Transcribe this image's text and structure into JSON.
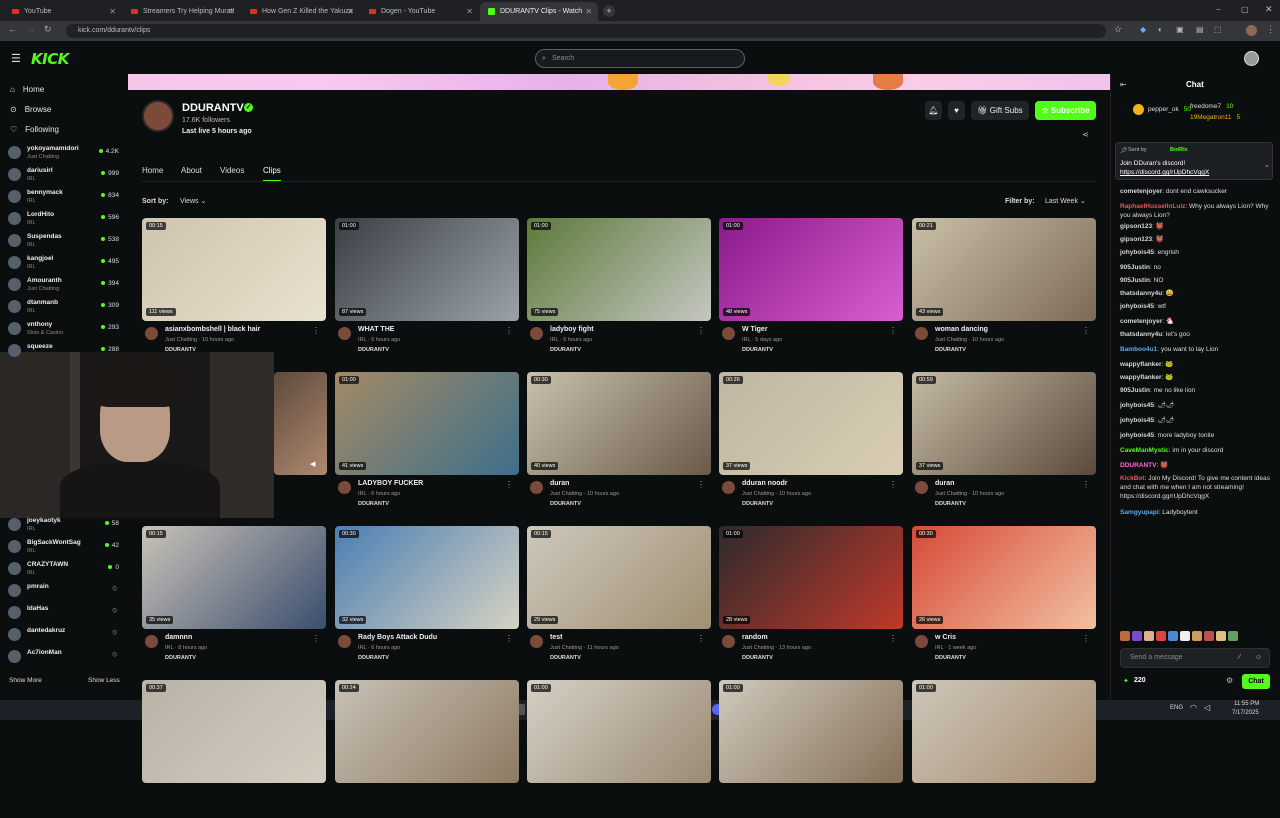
{
  "browser": {
    "tabs": [
      {
        "title": "YouTube",
        "icon": "youtube-icon",
        "active": false
      },
      {
        "title": "Streamers Try Helping Murat!",
        "icon": "youtube-icon",
        "active": false
      },
      {
        "title": "How Gen Z Killed the Yakuza",
        "icon": "youtube-icon",
        "active": false
      },
      {
        "title": "Dogen - YouTube",
        "icon": "youtube-icon",
        "active": false
      },
      {
        "title": "DDURANTV Clips - Watch",
        "icon": "kick-icon",
        "active": true
      }
    ],
    "url": "kick.com/ddurantv/clips"
  },
  "header": {
    "logo": "KICK",
    "search_placeholder": "Search"
  },
  "sidebar": {
    "nav": [
      {
        "label": "Home",
        "icon": "home-icon"
      },
      {
        "label": "Browse",
        "icon": "compass-icon"
      },
      {
        "label": "Following",
        "icon": "heart-icon"
      }
    ],
    "following": [
      {
        "name": "yokoyamamidori",
        "category": "Just Chatting",
        "viewers": "4.2K",
        "live": true
      },
      {
        "name": "dariusirl",
        "category": "IRL",
        "viewers": "999",
        "live": true
      },
      {
        "name": "bennymack",
        "category": "IRL",
        "viewers": "834",
        "live": true
      },
      {
        "name": "LordHito",
        "category": "IRL",
        "viewers": "596",
        "live": true
      },
      {
        "name": "Suspendas",
        "category": "IRL",
        "viewers": "538",
        "live": true
      },
      {
        "name": "kangjoel",
        "category": "IRL",
        "viewers": "495",
        "live": true
      },
      {
        "name": "Amouranth",
        "category": "Just Chatting",
        "viewers": "394",
        "live": true
      },
      {
        "name": "dtanmanb",
        "category": "IRL",
        "viewers": "309",
        "live": true
      },
      {
        "name": "vnthony",
        "category": "Slots & Casino",
        "viewers": "293",
        "live": true
      },
      {
        "name": "squeeze",
        "category": "",
        "viewers": "288",
        "live": true
      }
    ],
    "following_lower": [
      {
        "name": "joeykaotyk",
        "category": "IRL",
        "viewers": "58",
        "live": true
      },
      {
        "name": "BigSackWontSag",
        "category": "IRL",
        "viewers": "42",
        "live": true
      },
      {
        "name": "CRAZYTAWN",
        "category": "IRL",
        "viewers": "0",
        "live": true
      },
      {
        "name": "pmrain",
        "category": "",
        "viewers": "",
        "live": false
      },
      {
        "name": "IdaHas",
        "category": "",
        "viewers": "",
        "live": false
      },
      {
        "name": "dantedakruz",
        "category": "",
        "viewers": "",
        "live": false
      },
      {
        "name": "Ac7ionMan",
        "category": "",
        "viewers": "",
        "live": false
      }
    ],
    "show_more": "Show More",
    "show_less": "Show Less"
  },
  "channel": {
    "name": "DDURANTV",
    "followers": "17.6K followers",
    "last_live": "Last live 5 hours ago",
    "gift_subs": "Gift Subs",
    "subscribe": "Subscribe",
    "tabs": [
      "Home",
      "About",
      "Videos",
      "Clips"
    ],
    "active_tab": "Clips",
    "sort_label": "Sort by:",
    "sort_value": "Views",
    "filter_label": "Filter by:",
    "filter_value": "Last Week"
  },
  "clips": [
    {
      "duration": "00:15",
      "views": "111 views",
      "title": "asianxbombshell | black hair",
      "meta": "Just Chatting · 10 hours ago",
      "channel": "DDURANTV",
      "c1": "#cfc4ad",
      "c2": "#e9e2cf"
    },
    {
      "duration": "01:00",
      "views": "87 views",
      "title": "WHAT THE",
      "meta": "IRL · 6 hours ago",
      "channel": "DDURANTV",
      "c1": "#3b3f45",
      "c2": "#9aa3a9"
    },
    {
      "duration": "01:00",
      "views": "75 views",
      "title": "ladyboy fight",
      "meta": "IRL · 6 hours ago",
      "channel": "DDURANTV",
      "c1": "#5c7a3a",
      "c2": "#c5c7c2"
    },
    {
      "duration": "01:00",
      "views": "48 views",
      "title": "W Tiger",
      "meta": "IRL · 5 days ago",
      "channel": "DDURANTV",
      "c1": "#8a1a8c",
      "c2": "#d95fd0"
    },
    {
      "duration": "00:21",
      "views": "43 views",
      "title": "woman dancing",
      "meta": "Just Chatting · 10 hours ago",
      "channel": "DDURANTV",
      "c1": "#c9c0a7",
      "c2": "#7d6a58"
    },
    {
      "duration": "",
      "views": "",
      "title": "",
      "meta": "",
      "channel": "",
      "c1": "#5d4a3c",
      "c2": "#b08970"
    },
    {
      "duration": "01:00",
      "views": "41 views",
      "title": "LADYBOY FUCKER",
      "meta": "IRL · 6 hours ago",
      "channel": "DDURANTV",
      "c1": "#a48a65",
      "c2": "#3d6f8a"
    },
    {
      "duration": "00:30",
      "views": "40 views",
      "title": "duran",
      "meta": "Just Chatting · 10 hours ago",
      "channel": "DDURANTV",
      "c1": "#c8c1ad",
      "c2": "#6a5a49"
    },
    {
      "duration": "00:26",
      "views": "37 views",
      "title": "dduran noodr",
      "meta": "Just Chatting · 10 hours ago",
      "channel": "DDURANTV",
      "c1": "#bfb7a2",
      "c2": "#d8cdb3"
    },
    {
      "duration": "00:59",
      "views": "37 views",
      "title": "duran",
      "meta": "Just Chatting · 10 hours ago",
      "channel": "DDURANTV",
      "c1": "#c4bba4",
      "c2": "#5b4a3c"
    },
    {
      "duration": "00:15",
      "views": "35 views",
      "title": "damnnn",
      "meta": "IRL · 8 hours ago",
      "channel": "DDURANTV",
      "c1": "#c9c3b8",
      "c2": "#3b4e6e"
    },
    {
      "duration": "00:30",
      "views": "32 views",
      "title": "Rady Boys Attack Dudu",
      "meta": "IRL · 6 hours ago",
      "channel": "DDURANTV",
      "c1": "#4b7fb3",
      "c2": "#d6d2c3"
    },
    {
      "duration": "00:15",
      "views": "29 views",
      "title": "test",
      "meta": "Just Chatting · 11 hours ago",
      "channel": "DDURANTV",
      "c1": "#cdc7bb",
      "c2": "#a09073"
    },
    {
      "duration": "01:00",
      "views": "28 views",
      "title": "random",
      "meta": "Just Chatting · 13 hours ago",
      "channel": "DDURANTV",
      "c1": "#2d2a2c",
      "c2": "#c0392b"
    },
    {
      "duration": "00:30",
      "views": "26 views",
      "title": "w Cris",
      "meta": "IRL · 1 week ago",
      "channel": "DDURANTV",
      "c1": "#d84a3a",
      "c2": "#f1c0a0"
    },
    {
      "duration": "00:37",
      "views": "",
      "title": "",
      "meta": "",
      "channel": "",
      "c1": "#b9b3a7",
      "c2": "#d3cdc0"
    },
    {
      "duration": "00:24",
      "views": "",
      "title": "",
      "meta": "",
      "channel": "",
      "c1": "#c7c1b5",
      "c2": "#8e7a62"
    },
    {
      "duration": "01:00",
      "views": "",
      "title": "",
      "meta": "",
      "channel": "",
      "c1": "#d5d0c5",
      "c2": "#9a8a74"
    },
    {
      "duration": "01:00",
      "views": "",
      "title": "",
      "meta": "",
      "channel": "",
      "c1": "#cfc9bc",
      "c2": "#857058"
    },
    {
      "duration": "01:00",
      "views": "",
      "title": "",
      "meta": "",
      "channel": "",
      "c1": "#cdc6b9",
      "c2": "#a68c70"
    }
  ],
  "chat": {
    "title": "Chat",
    "leaderboard": [
      {
        "name": "pepper_ok",
        "value": "50"
      },
      {
        "name": "freedome7",
        "value": "10"
      },
      {
        "name": "19Megatron11",
        "value": "5"
      }
    ],
    "pinned_by": "Sent by",
    "pinned_user": "BotRix",
    "pinned_text": "Join DDuran's discord!",
    "pinned_link": "https://discord.gg/rUpDhcVqgX",
    "messages": [
      {
        "user": "cometenjoyer",
        "text": "dont end cawksucker",
        "color": "#d6d6d6"
      },
      {
        "user": "RaphaelHussellnLuiz",
        "text": "Why you always Lion? Why you always Lion?",
        "color": "#e05a5a"
      },
      {
        "user": "gipson123",
        "text": "👹",
        "color": "#d6d6d6"
      },
      {
        "user": "gipson123",
        "text": "👹",
        "color": "#d6d6d6"
      },
      {
        "user": "johybois45",
        "text": "engrish",
        "color": "#d6d6d6"
      },
      {
        "user": "905Justin",
        "text": "no",
        "color": "#d6d6d6"
      },
      {
        "user": "905Justin",
        "text": "NO",
        "color": "#d6d6d6"
      },
      {
        "user": "thatsdanny4u",
        "text": "😀",
        "color": "#d6d6d6"
      },
      {
        "user": "johybois45",
        "text": "wtf",
        "color": "#d6d6d6"
      },
      {
        "user": "cometenjoyer",
        "text": "🐔",
        "color": "#d6d6d6"
      },
      {
        "user": "thatsdanny4u",
        "text": "let's goo",
        "color": "#d6d6d6"
      },
      {
        "user": "Bamboo4u1",
        "text": "you want to lay Lion",
        "color": "#5fa8e8"
      },
      {
        "user": "wappyflanker",
        "text": "🐸",
        "color": "#d6d6d6"
      },
      {
        "user": "wappyflanker",
        "text": "🐸",
        "color": "#d6d6d6"
      },
      {
        "user": "905Justin",
        "text": "me no like lion",
        "color": "#d6d6d6"
      },
      {
        "user": "johybois45",
        "text": "🌶🌶",
        "color": "#d6d6d6"
      },
      {
        "user": "johybois45",
        "text": "🌶🌶",
        "color": "#d6d6d6"
      },
      {
        "user": "johybois45",
        "text": "more ladyboy tonite",
        "color": "#d6d6d6"
      },
      {
        "user": "CaveManMystic",
        "text": "im in your discord",
        "color": "#53fc18"
      },
      {
        "user": "DDURANTV",
        "text": "👹",
        "color": "#ff6bd6"
      },
      {
        "user": "KickBot",
        "text": "Join My Discord! To give me content ideas and chat with me when I am not streaming! https://discord.gg/rUpDhcVqgX",
        "color": "#e05a5a"
      },
      {
        "user": "Samgyupapi",
        "text": "Ladyboytent",
        "color": "#5fa8e8"
      }
    ],
    "input_placeholder": "Send a message",
    "points": "220",
    "send_label": "Chat"
  },
  "taskbar": {
    "lang": "ENG",
    "time": "11:55 PM",
    "date": "7/17/2025"
  }
}
